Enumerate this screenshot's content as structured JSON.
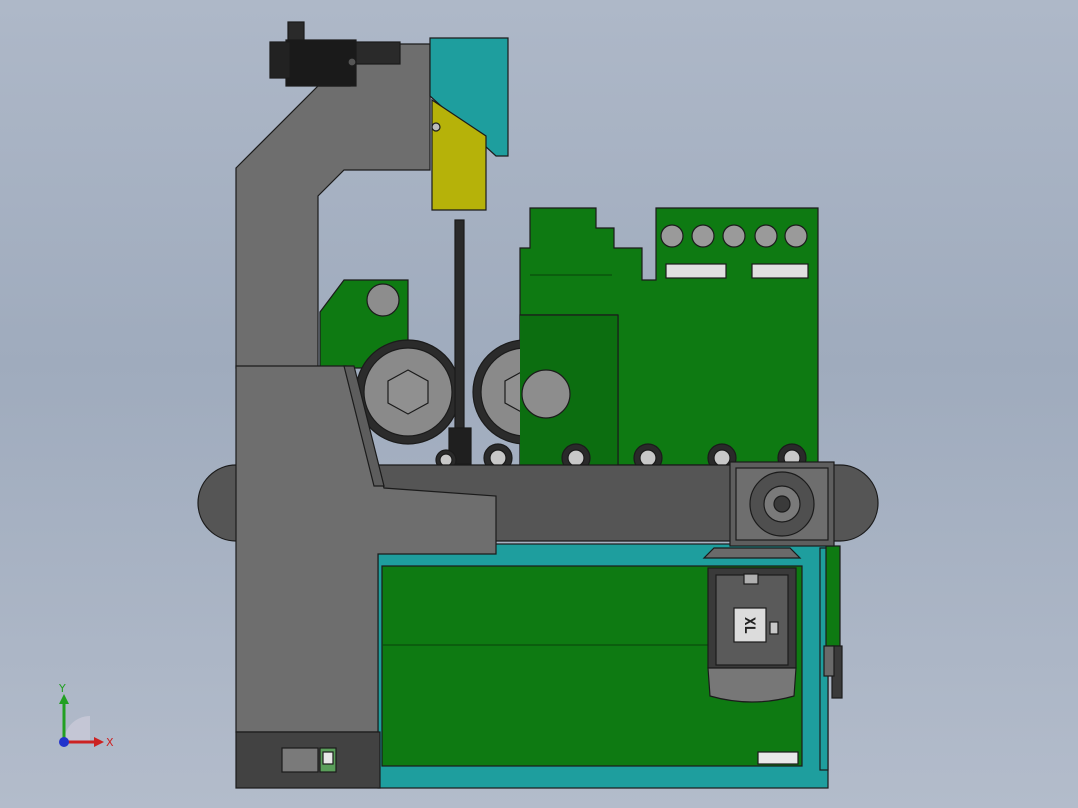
{
  "view": {
    "motor_nameplate": "XL",
    "triad": {
      "x_label": "X",
      "y_label": "Y"
    },
    "colors": {
      "background": "#a7b2c3",
      "frame_gray": "#6e6e6e",
      "frame_dark": "#4a4a4a",
      "panel_green": "#0e7a12",
      "teal": "#1e9e9e",
      "yellow": "#b6b209",
      "black": "#1a1a1a"
    }
  }
}
